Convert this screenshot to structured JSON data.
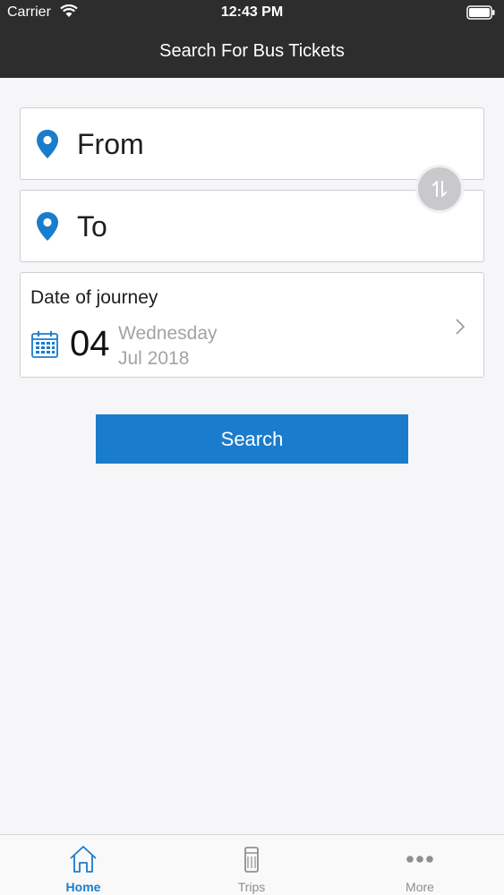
{
  "status_bar": {
    "carrier": "Carrier",
    "time": "12:43 PM"
  },
  "header": {
    "title": "Search For Bus Tickets"
  },
  "search_form": {
    "from_placeholder": "From",
    "to_placeholder": "To",
    "date": {
      "label": "Date of journey",
      "day": "04",
      "weekday": "Wednesday",
      "month_year": "Jul 2018"
    },
    "search_button": "Search"
  },
  "tab_bar": {
    "tabs": [
      {
        "label": "Home",
        "icon": "home-icon",
        "active": true
      },
      {
        "label": "Trips",
        "icon": "ticket-icon",
        "active": false
      },
      {
        "label": "More",
        "icon": "more-icon",
        "active": false
      }
    ]
  },
  "colors": {
    "accent": "#1a7ccc",
    "header_bg": "#2d2d2d",
    "page_bg": "#f6f6f8",
    "muted_text": "#a3a3a6"
  }
}
